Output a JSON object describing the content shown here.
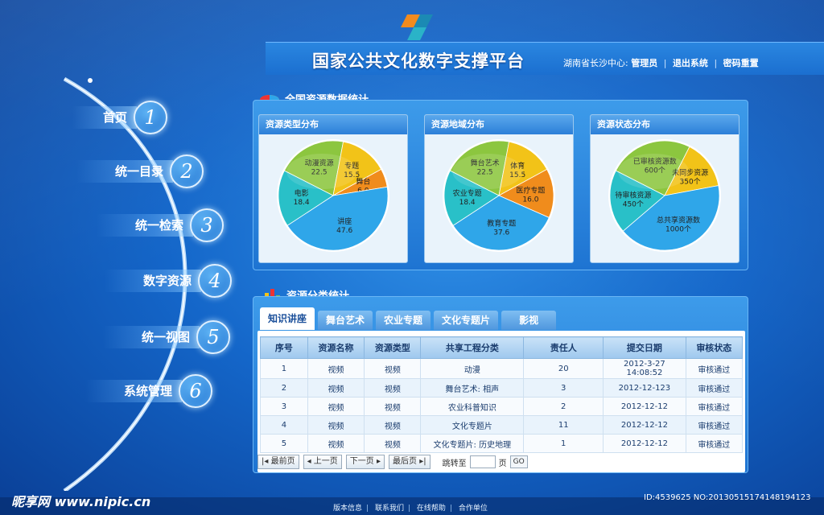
{
  "header": {
    "title": "国家公共文化数字支撑平台",
    "location": "湖南省长沙中心:",
    "links": [
      "管理员",
      "退出系统",
      "密码重置"
    ],
    "link_seps": [
      "|",
      "|"
    ]
  },
  "nav": [
    {
      "label": "首页",
      "num": "1"
    },
    {
      "label": "统一目录",
      "num": "2"
    },
    {
      "label": "统一检索",
      "num": "3"
    },
    {
      "label": "数字资源",
      "num": "4"
    },
    {
      "label": "统一视图",
      "num": "5"
    },
    {
      "label": "系统管理",
      "num": "6"
    }
  ],
  "stats": {
    "title": "全国资源数据统计"
  },
  "charts": {
    "type": {
      "title": "资源类型分布"
    },
    "region": {
      "title": "资源地域分布"
    },
    "status": {
      "title": "资源状态分布"
    }
  },
  "chart_data": [
    {
      "type": "pie",
      "title": "资源类型分布",
      "slices": [
        {
          "label": "动漫资源",
          "value": "22.5",
          "color": "#8cc63f"
        },
        {
          "label": "专题",
          "value": "15.5",
          "color": "#f2c318"
        },
        {
          "label": "舞台",
          "value": "6.0",
          "color": "#f08c1c"
        },
        {
          "label": "讲座",
          "value": "47.6",
          "color": "#2fa6e9"
        },
        {
          "label": "电影",
          "value": "18.4",
          "color": "#29c0c8"
        }
      ]
    },
    {
      "type": "pie",
      "title": "资源地域分布",
      "slices": [
        {
          "label": "舞台艺术",
          "value": "22.5",
          "color": "#8cc63f"
        },
        {
          "label": "体育",
          "value": "15.5",
          "color": "#f2c318"
        },
        {
          "label": "医疗专题",
          "value": "16.0",
          "color": "#f08c1c"
        },
        {
          "label": "教育专题",
          "value": "37.6",
          "color": "#2fa6e9"
        },
        {
          "label": "农业专题",
          "value": "18.4",
          "color": "#29c0c8"
        }
      ]
    },
    {
      "type": "pie",
      "title": "资源状态分布",
      "slices": [
        {
          "label": "已审核资源数",
          "value": "600个",
          "color": "#8cc63f"
        },
        {
          "label": "未同步资源",
          "value": "350个",
          "color": "#f2c318"
        },
        {
          "label": "总共享资源数",
          "value": "1000个",
          "color": "#2fa6e9"
        },
        {
          "label": "待审核资源",
          "value": "450个",
          "color": "#29c0c8"
        }
      ]
    }
  ],
  "classify": {
    "title": "资源分类统计",
    "tabs": [
      "知识讲座",
      "舞台艺术",
      "农业专题",
      "文化专题片",
      "影视"
    ],
    "columns": [
      "序号",
      "资源名称",
      "资源类型",
      "共享工程分类",
      "责任人",
      "提交日期",
      "审核状态"
    ],
    "rows": [
      [
        "1",
        "视频",
        "视频",
        "动漫",
        "20",
        "2012-3-27 14:08:52",
        "审核通过"
      ],
      [
        "2",
        "视频",
        "视频",
        "舞台艺术: 相声",
        "3",
        "2012-12-123",
        "审核通过"
      ],
      [
        "3",
        "视频",
        "视频",
        "农业科普知识",
        "2",
        "2012-12-12",
        "审核通过"
      ],
      [
        "4",
        "视频",
        "视频",
        "文化专题片",
        "11",
        "2012-12-12",
        "审核通过"
      ],
      [
        "5",
        "视频",
        "视频",
        "文化专题片: 历史地理",
        "1",
        "2012-12-12",
        "审核通过"
      ]
    ],
    "pager": {
      "first": "最前页",
      "prev": "上一页",
      "next": "下一页",
      "last": "最后页",
      "jump": "跳转至",
      "page": "页",
      "go": "GO"
    }
  },
  "footer": {
    "links": [
      "版本信息",
      "联系我们",
      "在线帮助",
      "合作单位"
    ],
    "sep": "|",
    "watermark_left": "昵享网 www.nipic.cn",
    "watermark_right": "ID:4539625 NO:20130515174148194123"
  }
}
